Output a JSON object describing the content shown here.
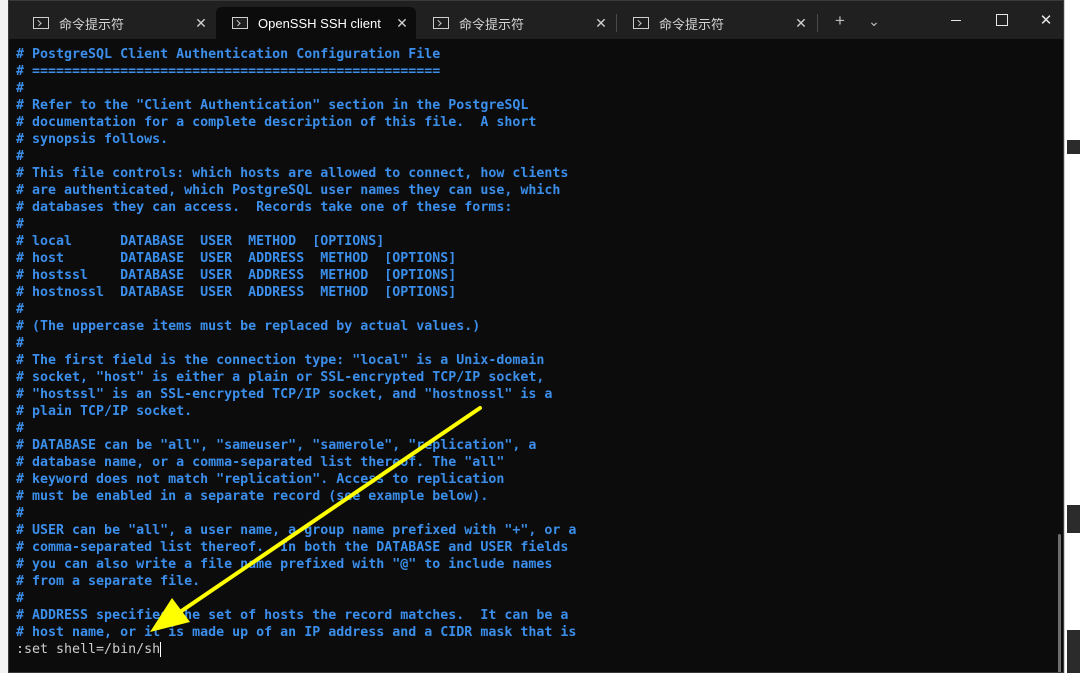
{
  "tabs": [
    {
      "label": "命令提示符",
      "close": "✕",
      "active": false
    },
    {
      "label": "OpenSSH SSH client",
      "close": "✕",
      "active": true
    },
    {
      "label": "命令提示符",
      "close": "✕",
      "active": false
    },
    {
      "label": "命令提示符",
      "close": "✕",
      "active": false
    }
  ],
  "toolbar": {
    "new_tab": "+",
    "dropdown": "⌄"
  },
  "window_controls": {
    "close": "✕"
  },
  "terminal": {
    "lines": [
      "# PostgreSQL Client Authentication Configuration File",
      "# ===================================================",
      "#",
      "# Refer to the \"Client Authentication\" section in the PostgreSQL",
      "# documentation for a complete description of this file.  A short",
      "# synopsis follows.",
      "#",
      "# This file controls: which hosts are allowed to connect, how clients",
      "# are authenticated, which PostgreSQL user names they can use, which",
      "# databases they can access.  Records take one of these forms:",
      "#",
      "# local      DATABASE  USER  METHOD  [OPTIONS]",
      "# host       DATABASE  USER  ADDRESS  METHOD  [OPTIONS]",
      "# hostssl    DATABASE  USER  ADDRESS  METHOD  [OPTIONS]",
      "# hostnossl  DATABASE  USER  ADDRESS  METHOD  [OPTIONS]",
      "#",
      "# (The uppercase items must be replaced by actual values.)",
      "#",
      "# The first field is the connection type: \"local\" is a Unix-domain",
      "# socket, \"host\" is either a plain or SSL-encrypted TCP/IP socket,",
      "# \"hostssl\" is an SSL-encrypted TCP/IP socket, and \"hostnossl\" is a",
      "# plain TCP/IP socket.",
      "#",
      "# DATABASE can be \"all\", \"sameuser\", \"samerole\", \"replication\", a",
      "# database name, or a comma-separated list thereof. The \"all\"",
      "# keyword does not match \"replication\". Access to replication",
      "# must be enabled in a separate record (see example below).",
      "#",
      "# USER can be \"all\", a user name, a group name prefixed with \"+\", or a",
      "# comma-separated list thereof.  In both the DATABASE and USER fields",
      "# you can also write a file name prefixed with \"@\" to include names",
      "# from a separate file.",
      "#",
      "# ADDRESS specifies the set of hosts the record matches.  It can be a",
      "# host name, or it is made up of an IP address and a CIDR mask that is"
    ],
    "command": ":set shell=/bin/sh"
  },
  "colors": {
    "comment_text": "#3b8eea",
    "terminal_bg": "#0c0c0c",
    "titlebar_bg": "#202020",
    "annotation_arrow": "#ffff00"
  }
}
